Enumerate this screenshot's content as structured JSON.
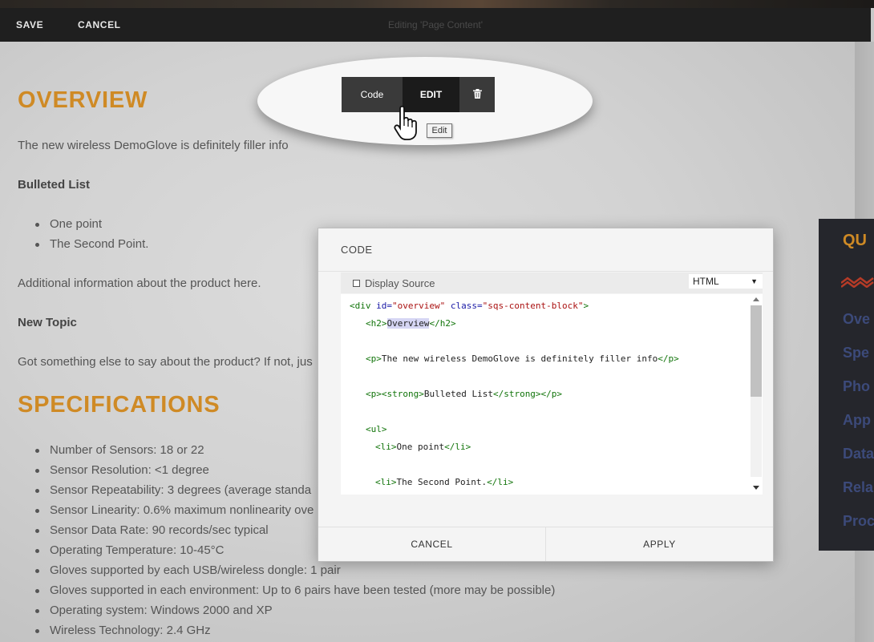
{
  "topbar": {
    "save": "SAVE",
    "cancel": "CANCEL",
    "title": "Editing 'Page Content'"
  },
  "block_toolbar": {
    "code": "Code",
    "edit": "EDIT",
    "trash_icon": "trash-icon",
    "tooltip": "Edit"
  },
  "page": {
    "overview_heading": "OVERVIEW",
    "overview_text": "The new wireless DemoGlove is definitely filler info",
    "bulleted_list_title": "Bulleted List",
    "bullets": [
      "One point",
      "The Second Point."
    ],
    "additional_info": "Additional information about the product here.",
    "new_topic": "New Topic",
    "new_topic_text": "Got something else to say about the product? If not, jus",
    "specifications_heading": "SPECIFICATIONS",
    "specs": [
      "Number of Sensors: 18 or 22",
      "Sensor Resolution: <1 degree",
      "Sensor Repeatability: 3 degrees (average standa",
      "Sensor Linearity: 0.6% maximum nonlinearity ove",
      "Sensor Data Rate: 90 records/sec typical",
      "Operating Temperature: 10-45°C",
      "Gloves supported by each USB/wireless dongle: 1 pair",
      "Gloves supported in each environment: Up to 6 pairs have been tested (more may be possible)",
      "Operating system: Windows 2000 and XP",
      "Wireless Technology: 2.4 GHz"
    ]
  },
  "sidebar": {
    "title": "QU",
    "items": [
      "Ove",
      "Spe",
      "Pho",
      "App",
      "Data",
      "Rela",
      "Proc"
    ]
  },
  "dialog": {
    "title": "CODE",
    "display_source": "Display Source",
    "language": "HTML",
    "code": {
      "l1": {
        "open": "<div ",
        "attr1": "id=",
        "val1": "\"overview\"",
        "sp": " ",
        "attr2": "class=",
        "val2": "\"sqs-content-block\"",
        "close": ">"
      },
      "l2": {
        "open": "<h2>",
        "text": "Overview",
        "close": "</h2>"
      },
      "l3": {
        "open": "<p>",
        "text": "The new wireless DemoGlove is definitely filler info",
        "close": "</p>"
      },
      "l4": {
        "open": "<p><strong>",
        "text": "Bulleted List",
        "close": "</strong></p>"
      },
      "l5": {
        "open": "<ul>"
      },
      "l6": {
        "open": "<li>",
        "text": "One point",
        "close": "</li>"
      },
      "l7": {
        "open": "<li>",
        "text": "The Second Point.",
        "close": "</li>"
      }
    },
    "cancel": "CANCEL",
    "apply": "APPLY"
  },
  "colors": {
    "accent": "#cf8a25",
    "toolbar": "#1f1f1f",
    "sidebar_bg": "#25262c",
    "sidebar_link": "#3c4a7a"
  }
}
